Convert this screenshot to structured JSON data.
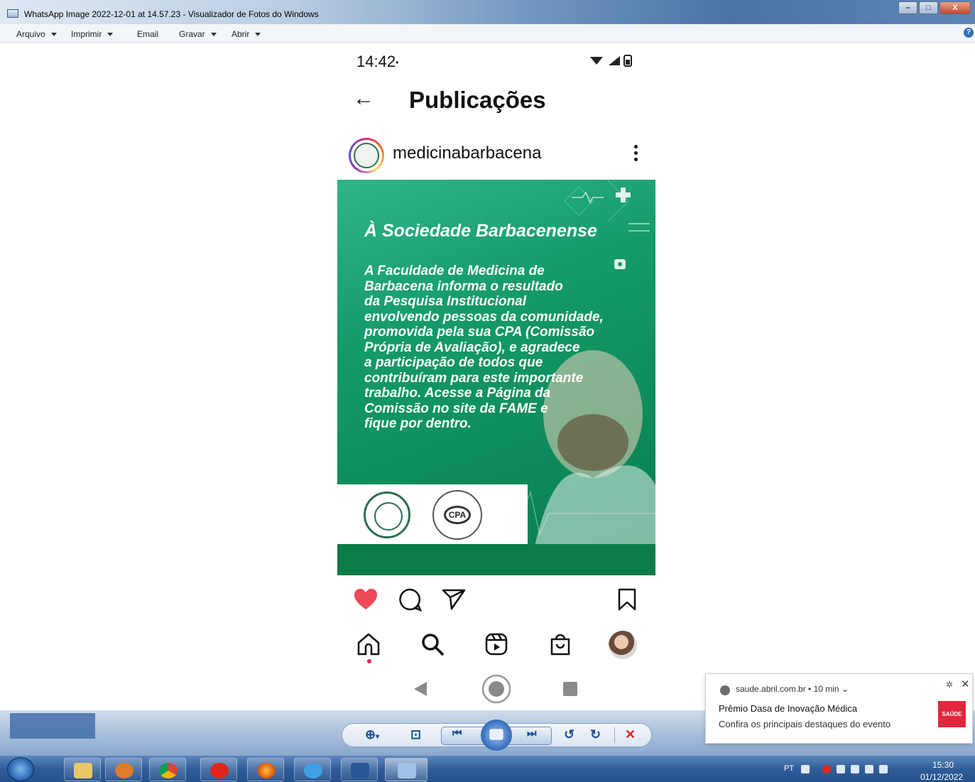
{
  "window": {
    "title": "WhatsApp Image 2022-12-01 at 14.57.23 - Visualizador de Fotos do Windows",
    "controls": {
      "minimize": "–",
      "maximize": "□",
      "close": "X"
    }
  },
  "menu": {
    "items": [
      {
        "label": "Arquivo",
        "has_dropdown": true
      },
      {
        "label": "Imprimir",
        "has_dropdown": true
      },
      {
        "label": "Email",
        "has_dropdown": false
      },
      {
        "label": "Gravar",
        "has_dropdown": true
      },
      {
        "label": "Abrir",
        "has_dropdown": true
      }
    ],
    "help": "?"
  },
  "phone": {
    "status_time": "14:42",
    "status_dot": "•",
    "header": {
      "back": "←",
      "title": "Publicações"
    },
    "post_author": "medicinabarbacena",
    "post": {
      "headline": "À Sociedade Barbacenense",
      "body_segments": [
        {
          "text": "A Faculdade de Medicina de\nBarbacena informa  o ",
          "bold": false
        },
        {
          "text": "resultado\nda Pesquisa Institucional",
          "bold": true
        },
        {
          "text": "\nenvolvendo pessoas da comunidade,\npromovida pela sua ",
          "bold": false
        },
        {
          "text": "CPA (Comissão\n Própria de Avaliação)",
          "bold": true
        },
        {
          "text": ", e agradece\na participação de todos que\ncontribuíram para este importante\ntrabalho. Acesse a Página da\nComissão no site da FAME e\nfique por dentro.",
          "bold": false
        }
      ],
      "logo_cpa_text": "CPA"
    },
    "actions": [
      "heart-icon",
      "comment-icon",
      "share-icon",
      "bookmark-icon"
    ],
    "nav": [
      "home-icon",
      "search-icon",
      "reels-icon",
      "shop-icon",
      "profile-avatar"
    ],
    "system_nav": [
      "back-triangle",
      "home-circle",
      "recents-square"
    ]
  },
  "viewer_toolbar": {
    "zoom": "⊕",
    "zoom_caret": "▾",
    "fit": "⊡",
    "prev": "⏮",
    "next": "⏭",
    "rotate_ccw": "↺",
    "rotate_cw": "↻",
    "delete": "✕"
  },
  "notification": {
    "source": "saude.abril.com.br  •  10 min ⌄",
    "title": "Prêmio Dasa de Inovação Médica",
    "text": "Confira os principais destaques do evento",
    "gear": "✲",
    "close": "✕",
    "logo_text": "SAÚDE"
  },
  "taskbar": {
    "lang": "PT",
    "time": "15:30",
    "date": "01/12/2022"
  },
  "colors": {
    "post_green": "#0d8a5a",
    "heart_red": "#ed4956",
    "notif_red": "#e3263d",
    "taskbar_blue": "#2f5d9a"
  }
}
